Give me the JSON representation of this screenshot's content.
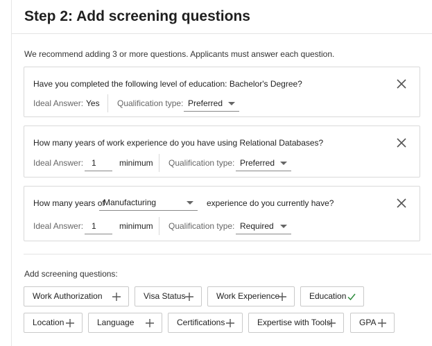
{
  "header": {
    "step": "Step 2:",
    "title": "Add screening questions"
  },
  "intro": "We recommend adding 3 or more questions. Applicants must answer each question.",
  "questions": [
    {
      "text": "Have you completed the following level of education: Bachelor's Degree?",
      "ideal_label": "Ideal Answer:",
      "ideal_value": "Yes",
      "qual_label": "Qualification type:",
      "qual_value": "Preferred"
    },
    {
      "text": "How many years of work experience do you have using Relational Databases?",
      "ideal_label": "Ideal Answer:",
      "ideal_value": "1",
      "ideal_suffix": "minimum",
      "qual_label": "Qualification type:",
      "qual_value": "Preferred"
    },
    {
      "text_prefix": "How many years of",
      "select_value": "Manufacturing",
      "text_suffix": "experience do you currently have?",
      "ideal_label": "Ideal Answer:",
      "ideal_value": "1",
      "ideal_suffix": "minimum",
      "qual_label": "Qualification type:",
      "qual_value": "Required"
    }
  ],
  "add_section": {
    "label": "Add screening questions:",
    "chips": [
      {
        "label": "Work Authorization",
        "icon": "plus-icon"
      },
      {
        "label": "Visa Status",
        "icon": "plus-icon"
      },
      {
        "label": "Work Experience",
        "icon": "plus-icon"
      },
      {
        "label": "Education",
        "icon": "check-icon"
      },
      {
        "label": "Location",
        "icon": "plus-icon"
      },
      {
        "label": "Language",
        "icon": "plus-icon"
      },
      {
        "label": "Certifications",
        "icon": "plus-icon"
      },
      {
        "label": "Expertise with Tools",
        "icon": "plus-icon"
      },
      {
        "label": "GPA",
        "icon": "plus-icon"
      }
    ]
  },
  "colors": {
    "check": "#2e8b3d",
    "icon": "#555555",
    "border": "#d9d9d9"
  }
}
